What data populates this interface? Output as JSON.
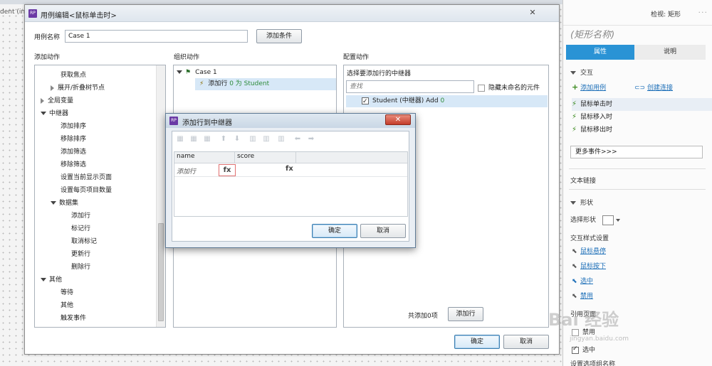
{
  "background": {
    "tab_text": "dent (in"
  },
  "right_panel": {
    "header_title": "检视: 矩形",
    "header_dots": "···",
    "shape_name": "(矩形名称)",
    "tabs": [
      "属性",
      "说明"
    ],
    "interaction_section": "交互",
    "add_case_link": "添加用例",
    "create_link": "创建连接",
    "events": [
      "鼠标单击时",
      "鼠标移入时",
      "鼠标移出时"
    ],
    "more_events": "更多事件>>>",
    "text_link": "文本链接",
    "shape_section": "形状",
    "select_shape_label": "选择形状",
    "interaction_style_label": "交互样式设置",
    "style_links": [
      "鼠标悬停",
      "鼠标按下",
      "选中",
      "禁用"
    ],
    "ref_page_label": "引用页面",
    "checks": [
      {
        "label": "禁用",
        "checked": false
      },
      {
        "label": "选中",
        "checked": true
      }
    ],
    "bottom_label": "设置选项组名称"
  },
  "main_dialog": {
    "logo": "RP",
    "title": "用例编辑<鼠标单击时>",
    "close": "✕",
    "case_name_label": "用例名称",
    "case_name_value": "Case 1",
    "add_condition_button": "添加条件",
    "col1_title": "添加动作",
    "col2_title": "组织动作",
    "col3_title": "配置动作",
    "actions_tree": [
      "获取焦点",
      "展开/折叠树节点",
      "全局变量",
      "中继器",
      "添加排序",
      "移除排序",
      "添加筛选",
      "移除筛选",
      "设置当前显示页面",
      "设置每页项目数量",
      "数据集",
      "添加行",
      "标记行",
      "取消标记",
      "更新行",
      "删除行",
      "其他",
      "等待",
      "其他",
      "触发事件"
    ],
    "organize": {
      "case_label": "Case 1",
      "action_label": "添加行",
      "action_detail": "0 为 Student"
    },
    "config": {
      "select_label": "选择要添加行的中继器",
      "search_placeholder": "查找",
      "hide_unnamed_label": "隐藏未命名的元件",
      "repeater_item": "Student (中继器) Add",
      "repeater_count": "0",
      "total_label": "共添加0项",
      "add_row_button": "添加行"
    },
    "ok_button": "确定",
    "cancel_button": "取消"
  },
  "popup": {
    "logo": "RP",
    "title": "添加行到中继器",
    "close": "✕",
    "toolbar_icons": [
      "insert-row-above-icon",
      "insert-row-below-icon",
      "delete-row-icon",
      "move-up-icon",
      "move-down-icon",
      "insert-column-left-icon",
      "insert-column-right-icon",
      "delete-column-icon",
      "move-left-icon",
      "move-right-icon"
    ],
    "toolbar_glyphs": [
      "▦",
      "▦",
      "▦",
      "⬆",
      "⬇",
      "▥",
      "▥",
      "▥",
      "⬅",
      "➡"
    ],
    "columns": [
      "name",
      "score"
    ],
    "row_label": "添加行",
    "fx": "fx",
    "ok_button": "确定",
    "cancel_button": "取消"
  },
  "watermark": {
    "text": "Bai 经验",
    "url": "jingyan.baidu.com"
  }
}
